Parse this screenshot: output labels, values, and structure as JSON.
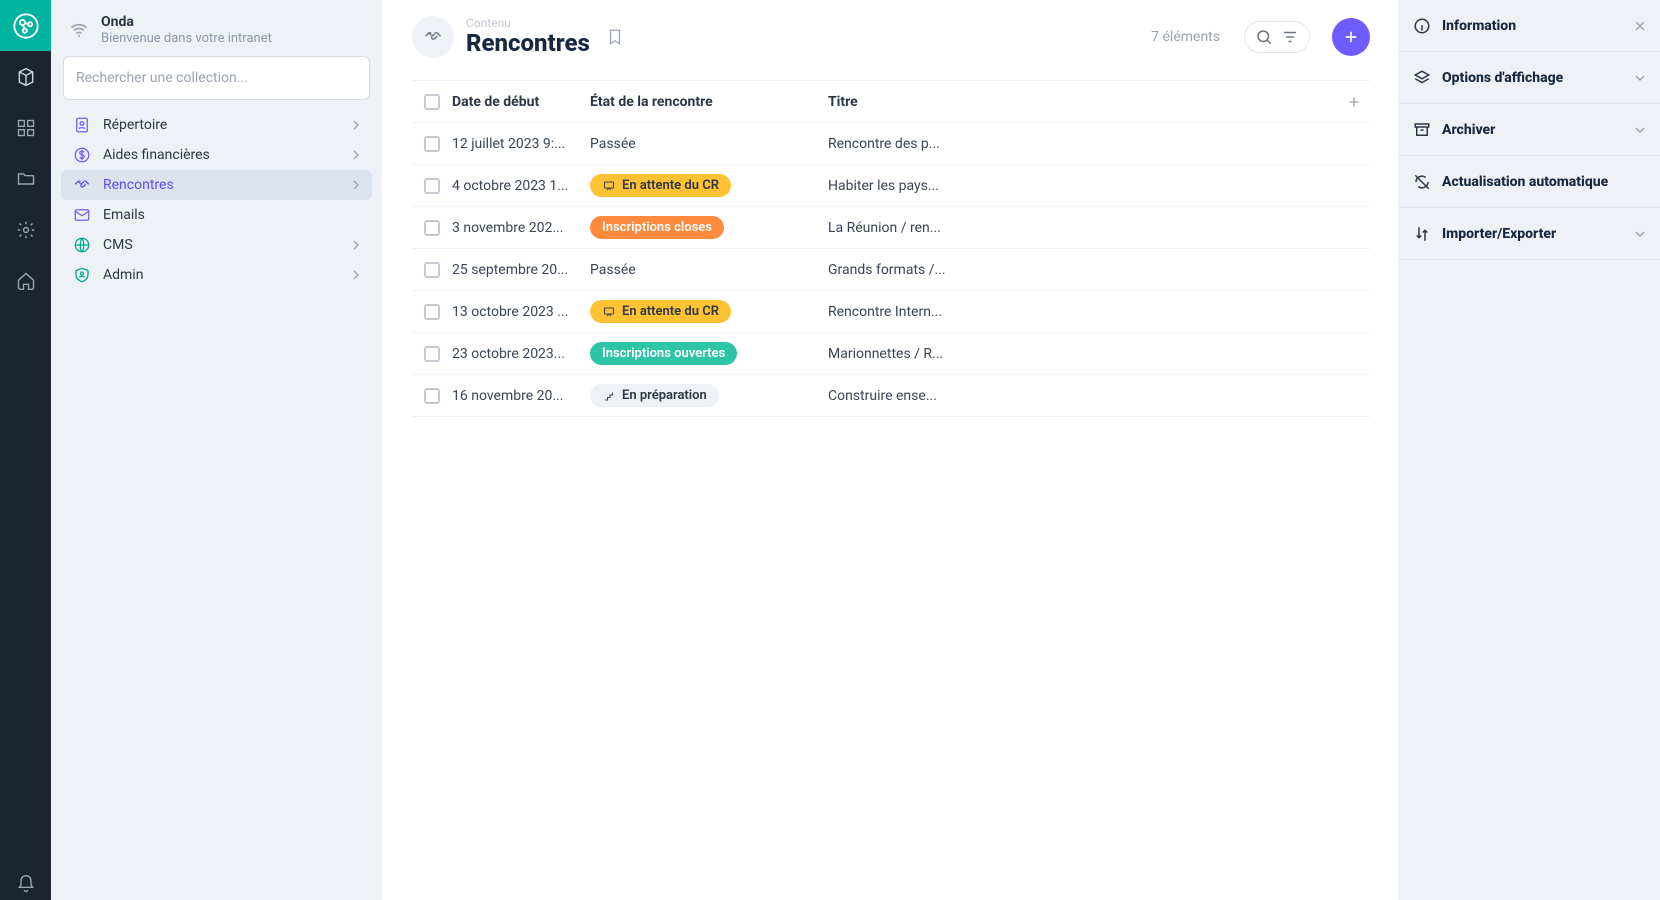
{
  "tenant": {
    "name": "Onda",
    "subtitle": "Bienvenue dans votre intranet"
  },
  "search": {
    "placeholder": "Rechercher une collection..."
  },
  "nav": {
    "items": [
      {
        "label": "Répertoire",
        "icon": "contacts-icon",
        "accent": "purple",
        "has_children": true
      },
      {
        "label": "Aides financières",
        "icon": "money-icon",
        "accent": "purple",
        "has_children": true
      },
      {
        "label": "Rencontres",
        "icon": "handshake-icon",
        "accent": "purple",
        "active": true,
        "has_children": true
      },
      {
        "label": "Emails",
        "icon": "mail-icon",
        "accent": "purple",
        "has_children": false
      },
      {
        "label": "CMS",
        "icon": "globe-icon",
        "accent": "teal",
        "has_children": true
      },
      {
        "label": "Admin",
        "icon": "shield-user-icon",
        "accent": "teal",
        "has_children": true
      }
    ]
  },
  "page": {
    "eyebrow": "Contenu",
    "title": "Rencontres",
    "count": "7 éléments"
  },
  "columns": {
    "date": "Date de début",
    "status": "État de la rencontre",
    "title": "Titre"
  },
  "rows": [
    {
      "date": "12 juillet 2023 9:...",
      "status": {
        "kind": "text",
        "text": "Passée"
      },
      "title": "Rencontre des p..."
    },
    {
      "date": "4 octobre 2023 1...",
      "status": {
        "kind": "amber",
        "icon": "presentation-icon",
        "text": "En attente du CR"
      },
      "title": "Habiter les pays..."
    },
    {
      "date": "3 novembre 202...",
      "status": {
        "kind": "orange",
        "text": "Inscriptions closes"
      },
      "title": "La Réunion / ren..."
    },
    {
      "date": "25 septembre 20...",
      "status": {
        "kind": "text",
        "text": "Passée"
      },
      "title": "Grands formats /..."
    },
    {
      "date": "13 octobre 2023 ...",
      "status": {
        "kind": "amber",
        "icon": "presentation-icon",
        "text": "En attente du CR"
      },
      "title": "Rencontre Intern..."
    },
    {
      "date": "23 octobre 2023...",
      "status": {
        "kind": "emerald",
        "text": "Inscriptions ouvertes"
      },
      "title": "Marionnettes / R..."
    },
    {
      "date": "16 novembre 20...",
      "status": {
        "kind": "gray",
        "icon": "stairs-icon",
        "text": "En préparation"
      },
      "title": "Construire ense..."
    }
  ],
  "rightbar": {
    "sections": [
      {
        "label": "Information",
        "icon": "info-icon",
        "close": true
      },
      {
        "label": "Options d'affichage",
        "icon": "layers-icon",
        "chev": true
      },
      {
        "label": "Archiver",
        "icon": "archive-icon",
        "chev": true
      },
      {
        "label": "Actualisation automatique",
        "icon": "no-sync-icon"
      },
      {
        "label": "Importer/Exporter",
        "icon": "swap-vert-icon",
        "chev": true
      }
    ]
  }
}
